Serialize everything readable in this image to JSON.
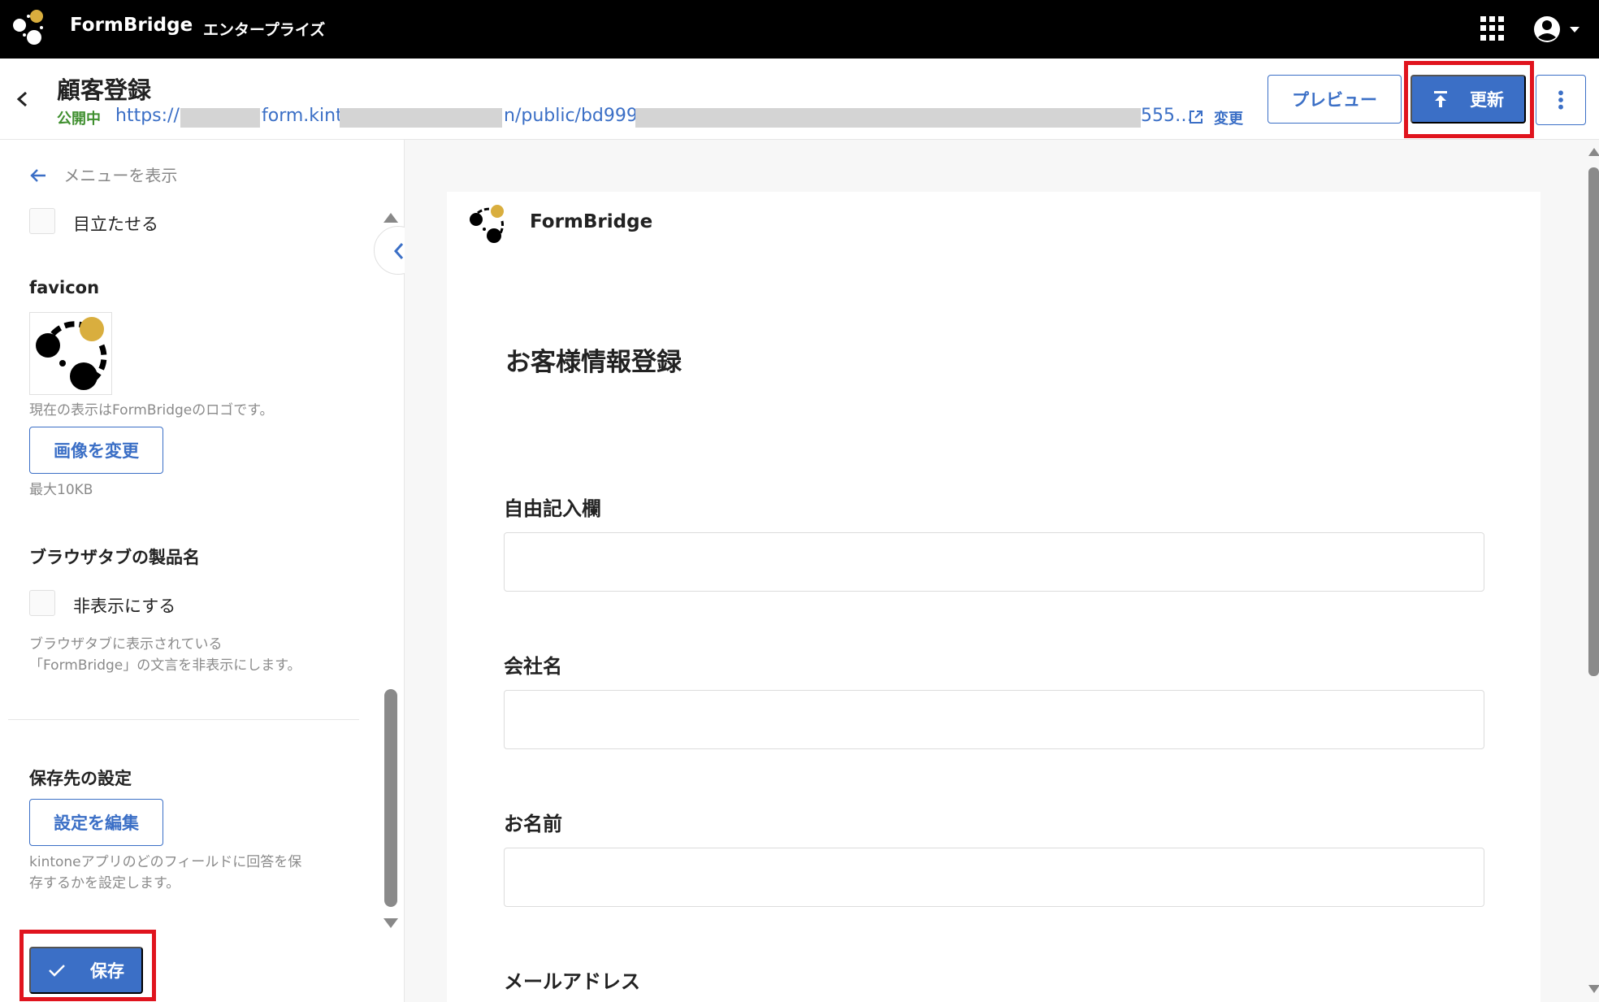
{
  "topbar": {
    "brand": "FormBridge",
    "edition": "エンタープライズ",
    "apps_icon": "apps-grid-icon",
    "account_icon": "account-circle-icon"
  },
  "header": {
    "title": "顧客登録",
    "status": "公開中",
    "url_parts": [
      "https://s",
      "form.kint",
      "n/public/bd999",
      "555…"
    ],
    "external_icon": "external-link-icon",
    "change_label": "変更",
    "preview_label": "プレビュー",
    "update_label": "更新",
    "more_icon": "more-vert-icon"
  },
  "left_panel": {
    "menu_back_label": "メニューを表示",
    "highlight_checkbox_label": "目立たせる",
    "favicon_title": "favicon",
    "favicon_hint": "現在の表示はFormBridgeのロゴです。",
    "change_image_label": "画像を変更",
    "max_size_hint": "最大10KB",
    "browser_tab_title": "ブラウザタブの製品名",
    "hide_checkbox_label": "非表示にする",
    "hide_hint_line1": "ブラウザタブに表示されている",
    "hide_hint_line2": "「FormBridge」の文言を非表示にします。",
    "save_dest_title": "保存先の設定",
    "edit_settings_label": "設定を編集",
    "save_dest_hint_line1": "kintoneアプリのどのフィールドに回答を保",
    "save_dest_hint_line2": "存するかを設定します。",
    "save_label": "保存"
  },
  "preview": {
    "brand": "FormBridge",
    "form_title": "お客様情報登録",
    "fields": [
      {
        "label": "自由記入欄",
        "value": ""
      },
      {
        "label": "会社名",
        "value": ""
      },
      {
        "label": "お名前",
        "value": ""
      },
      {
        "label": "メールアドレス",
        "value": ""
      }
    ]
  },
  "colors": {
    "accent": "#3b6fc6",
    "status_green": "#3f8f2f",
    "highlight_red": "#e0141e",
    "logo_gold": "#d9ae3e"
  }
}
